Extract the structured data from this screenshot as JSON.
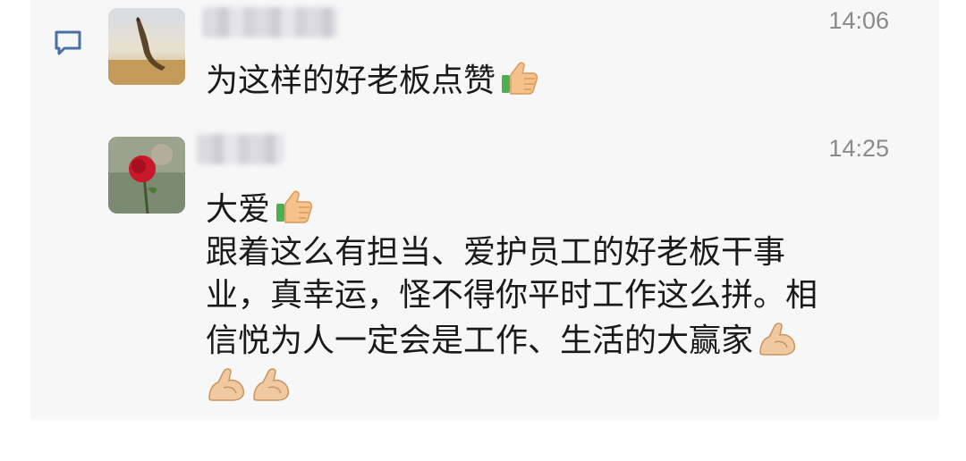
{
  "comments": [
    {
      "time": "14:06",
      "lines": [
        "为这样的好老板点赞"
      ],
      "emojis": [
        "thumbs-up"
      ]
    },
    {
      "time": "14:25",
      "lines": [
        "大爱",
        "跟着这么有担当、爱护员工的好老板干事",
        "业，真幸运，怪不得你平时工作这么拼。相",
        "信悦为人一定会是工作、生活的大赢家"
      ],
      "emojis": [
        "thumbs-up",
        "flexed-biceps",
        "flexed-biceps",
        "flexed-biceps"
      ]
    }
  ],
  "icons": {
    "comment": "comment-icon",
    "thumb": "thumbs-up-emoji",
    "muscle": "flexed-biceps-emoji"
  },
  "colors": {
    "panel_bg": "#f7f7f7",
    "time_text": "#8a8a8a",
    "body_text": "#1a1a1a",
    "comment_icon": "#4a6fa5"
  }
}
